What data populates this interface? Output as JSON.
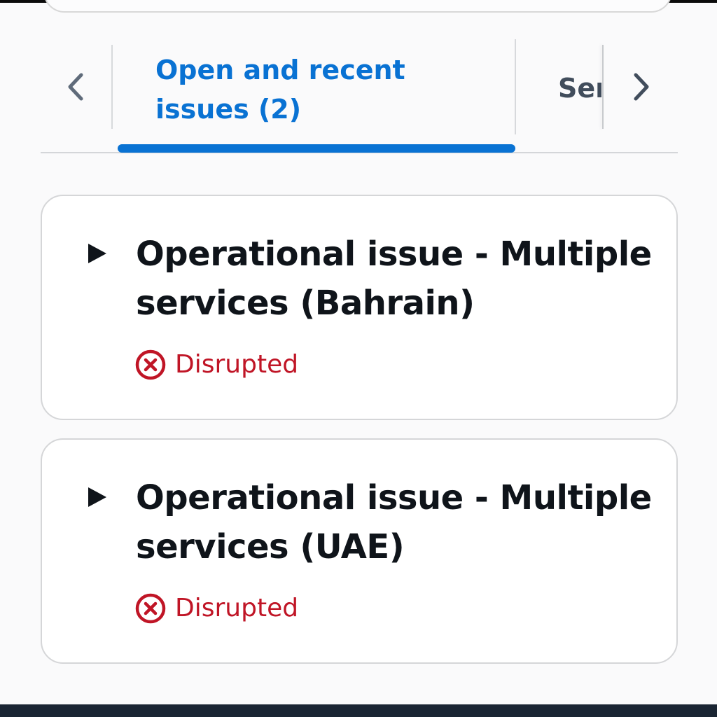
{
  "tabs": {
    "active": {
      "label": "Open and recent issues (2)"
    },
    "next": {
      "label": "Ser"
    },
    "prev_icon": "chevron-left-icon",
    "next_icon": "chevron-right-icon"
  },
  "issues": [
    {
      "title": "Operational issue - Multiple services (Bahrain)",
      "status": "Disrupted",
      "status_icon": "error-circle-icon"
    },
    {
      "title": "Operational issue - Multiple services (UAE)",
      "status": "Disrupted",
      "status_icon": "error-circle-icon"
    }
  ],
  "colors": {
    "accent": "#0972d3",
    "status_error": "#c01526",
    "text_primary": "#0f141a",
    "card_border": "#d5d6d8"
  }
}
